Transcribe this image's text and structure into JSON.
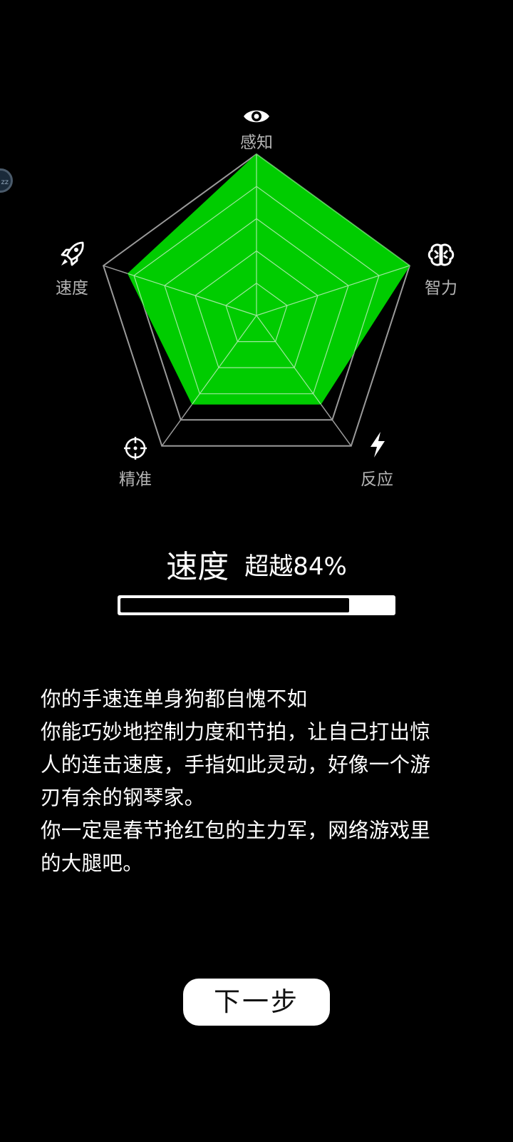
{
  "floating_ball": {
    "text": "zz"
  },
  "radar": {
    "axes": [
      {
        "label": "感知",
        "icon": "eye-icon",
        "value": 1.0
      },
      {
        "label": "智力",
        "icon": "brain-icon",
        "value": 1.0
      },
      {
        "label": "反应",
        "icon": "lightning-icon",
        "value": 0.68
      },
      {
        "label": "精准",
        "icon": "crosshair-icon",
        "value": 0.68
      },
      {
        "label": "速度",
        "icon": "rocket-icon",
        "value": 0.84
      }
    ],
    "levels": 5,
    "fill_color": "#00cc00",
    "outline_color": "#9a9a9a",
    "inner_line_color": "#9ee89e"
  },
  "result": {
    "dimension": "速度",
    "percentile_text": "超越84%",
    "percentile": 0.84
  },
  "description": {
    "lines": [
      "你的手速连单身狗都自愧不如",
      "你能巧妙地控制力度和节拍，让自己打出惊",
      "人的连击速度，手指如此灵动，好像一个游",
      "刃有余的钢琴家。",
      "你一定是春节抢红包的主力军，网络游戏里",
      "的大腿吧。"
    ]
  },
  "next_button": {
    "label": "下一步"
  }
}
